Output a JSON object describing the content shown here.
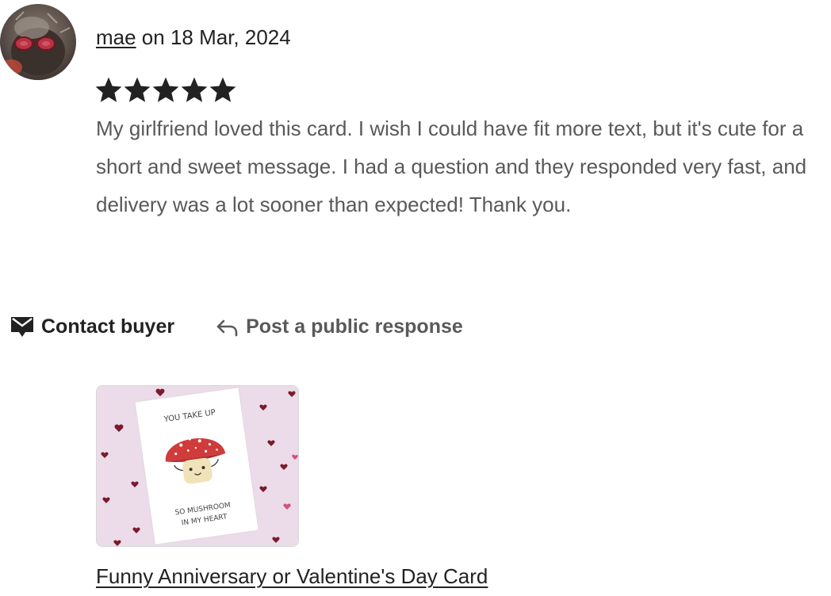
{
  "review": {
    "reviewer_name": "mae",
    "date_text": " on 18 Mar, 2024",
    "rating": 5,
    "rating_max": 5,
    "text": "My girlfriend loved this card. I wish I could have fit more text, but it's cute for a short and sweet message. I had a question and they responded very fast, and delivery was a lot sooner than expected! Thank you."
  },
  "actions": {
    "contact_label": "Contact buyer",
    "contact_icon": "envelope-icon",
    "public_label": "Post a public response",
    "public_icon": "reply-arrow-icon"
  },
  "listing": {
    "title": "Funny Anniversary or Valentine's Day Card",
    "card_text_top": "YOU TAKE UP",
    "card_text_mid": "SO MUSHROOM",
    "card_text_bottom": "IN MY HEART"
  },
  "colors": {
    "star": "#222222",
    "body_text": "#595959",
    "card_background": "#ecdcea",
    "mushroom_cap": "#d13b3b",
    "heart": "#8a1f2e"
  }
}
